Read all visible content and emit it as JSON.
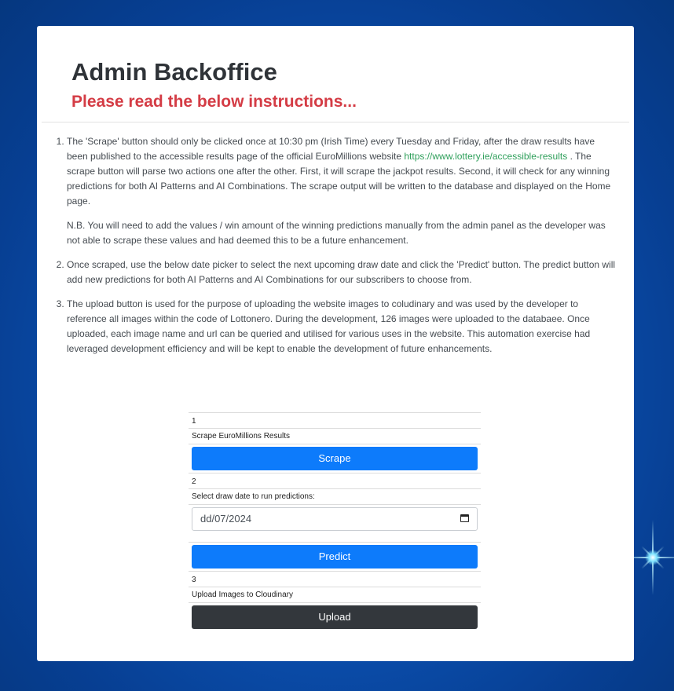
{
  "header": {
    "title": "Admin Backoffice",
    "subtitle": "Please read the below instructions..."
  },
  "instructions": {
    "item1_text_a": "The 'Scrape' button should only be clicked once at 10:30 pm (Irish Time) every Tuesday and Friday, after the draw results have been published to the accessible results page of the official EuroMillions website ",
    "item1_link": "https://www.lottery.ie/accessible-results",
    "item1_text_b": " . The scrape button will parse two actions one after the other. First, it will scrape the jackpot results. Second, it will check for any winning predictions for both AI Patterns and AI Combinations. The scrape output will be written to the database and displayed on the Home page.",
    "item1_nb": "N.B. You will need to add the values / win amount of the winning predictions manually from the admin panel as the developer was not able to scrape these values and had deemed this to be a future enhancement.",
    "item2": "Once scraped, use the below date picker to select the next upcoming draw date and click the 'Predict' button. The predict button will add new predictions for both AI Patterns and AI Combinations for our subscribers to choose from.",
    "item3": "The upload button is used for the purpose of uploading the website images to coludinary and was used by the developer to reference all images within the code of Lottonero. During the development, 126 images were uploaded to the databaee. Once uploaded, each image name and url can be queried and utilised for various uses in the website. This automation exercise had leveraged development efficiency and will be kept to enable the development of future enhancements."
  },
  "actions": {
    "step1_number": "1",
    "step1_label": "Scrape EuroMillions Results",
    "scrape_button": "Scrape",
    "step2_number": "2",
    "step2_label": "Select draw date to run predictions:",
    "date_value": "dd/07/2024",
    "predict_button": "Predict",
    "step3_number": "3",
    "step3_label": "Upload Images to Cloudinary",
    "upload_button": "Upload"
  },
  "colors": {
    "primary_button": "#0d7bfb",
    "dark_button": "#33373c",
    "subtitle": "#d43c45",
    "link": "#2e9f5a"
  }
}
